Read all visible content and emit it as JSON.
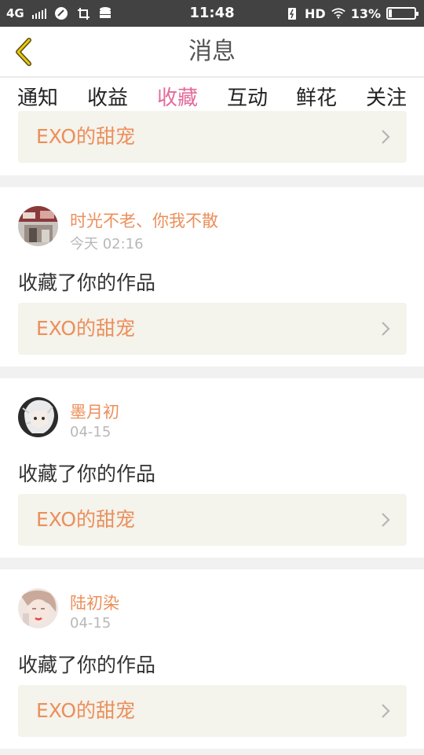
{
  "status_bar": {
    "network": "4G",
    "time": "11:48",
    "hd": "HD",
    "battery": "13%",
    "battery_level": 0.13
  },
  "header": {
    "title": "消息"
  },
  "tabs": [
    {
      "label": "通知"
    },
    {
      "label": "收益"
    },
    {
      "label": "收藏"
    },
    {
      "label": "互动"
    },
    {
      "label": "鲜花"
    },
    {
      "label": "关注"
    }
  ],
  "active_tab": "收藏",
  "top_partial": {
    "work_title": "EXO的甜宠"
  },
  "items": [
    {
      "user": "时光不老、你我不散",
      "time": "今天 02:16",
      "action": "收藏了你的作品",
      "work_title": "EXO的甜宠"
    },
    {
      "user": "墨月初",
      "time": "04-15",
      "action": "收藏了你的作品",
      "work_title": "EXO的甜宠"
    },
    {
      "user": "陆初染",
      "time": "04-15",
      "action": "收藏了你的作品",
      "work_title": "EXO的甜宠"
    }
  ],
  "colors": {
    "accent": "#e46a9a",
    "work_title": "#ec8f5b",
    "work_bg": "#f4f3ec",
    "status_bar": "#424242"
  },
  "icons": [
    "back-chevron-icon",
    "right-chevron-icon",
    "wifi-icon",
    "battery-icon",
    "signal-icon"
  ]
}
